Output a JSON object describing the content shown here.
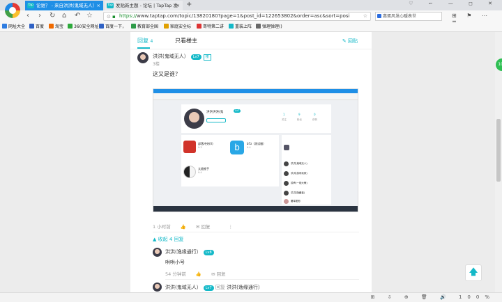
{
  "browser": {
    "tabs": [
      {
        "label": "论谁？ - 来自洪洪(鬼域无人）",
        "close": "×"
      },
      {
        "label": "发贴新主题 - 论坛 | TapTap 发",
        "close": "×"
      }
    ],
    "new_tab": "+",
    "tab_icon": "Tap",
    "window_controls": "♡ ⌐ — ◻ ✕",
    "address": {
      "https": "https://",
      "rest": "www.taptap.com/topic/13820180?page=1&post_id=122653802&order=asc&sort=posi"
    },
    "search_text": "惠蛋风发心暖表世",
    "bookmarks": [
      "网址大全",
      "百度",
      "淘宝",
      "360安全网址",
      "百度一下，",
      "教育部全国",
      "家庭安全标",
      "哥特第二讲",
      "重装上阵",
      "弹理弹理()"
    ]
  },
  "post": {
    "tab_reply": "回复",
    "tab_reply_count": "4",
    "tab_owner": "只看楼主",
    "reply_button": "回贴",
    "author": "洪洪(鬼域无人）",
    "level": "Lv7",
    "owner_badge": "楼",
    "floor": "3楼",
    "text": "这又是谁？",
    "time": "1 小时前",
    "reply_label": "回复",
    "more": "⋮",
    "collapse": "▲ 收起 4 回复"
  },
  "screenshot": {
    "user": "洪洪洪洪(鬼",
    "level": "Lv7",
    "stats": [
      {
        "n": "1",
        "l": "关注"
      },
      {
        "n": "9",
        "l": "粉丝"
      },
      {
        "n": "0",
        "l": "获赞"
      }
    ],
    "games": [
      {
        "name": "部落冲突(0)",
        "sub": "9.3"
      },
      {
        "name": "b7z（测试服）",
        "sub": "9.4"
      },
      {
        "name": "太极推手",
        "sub": "9.4"
      }
    ],
    "side_items": [
      "洪洪(鬼域无人)",
      "洪洪(游戏玩家)",
      "钟声(一炮大骨)",
      "洪洪(隐藏者)",
      "屠宰图形"
    ]
  },
  "subreplies": [
    {
      "author": "洪洪(逸缘通行）",
      "level": "Lv8",
      "text": "哄哄小号",
      "time": "54 分钟前",
      "reply": "回复"
    },
    {
      "author": "洪洪(鬼域无人）",
      "level": "Lv7",
      "reply": "回复",
      "target": "洪洪(逸缘通行）"
    }
  ],
  "float": {
    "green": "100",
    "up": "🡅"
  },
  "status_icons": "⊞ ⇩ ⊕ 🗑 🔊 100%"
}
